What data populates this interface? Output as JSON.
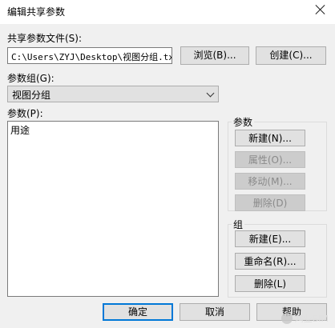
{
  "window": {
    "title": "编辑共享参数"
  },
  "file": {
    "label": "共享参数文件(S):",
    "path": "C:\\Users\\ZYJ\\Desktop\\视图分组.txt",
    "browse_label": "浏览(B)...",
    "create_label": "创建(C)..."
  },
  "param_group": {
    "label": "参数组(G):",
    "selected": "视图分组"
  },
  "params": {
    "label": "参数(P):",
    "items": [
      "用途"
    ]
  },
  "params_box": {
    "title": "参数",
    "new_label": "新建(N)...",
    "properties_label": "属性(O)...",
    "move_label": "移动(M)...",
    "delete_label": "删除(D)"
  },
  "group_box": {
    "title": "组",
    "new_label": "新建(E)...",
    "rename_label": "重命名(R)...",
    "delete_label": "删除(L)"
  },
  "footer": {
    "ok_label": "确定",
    "cancel_label": "取消",
    "help_label": "帮助"
  },
  "watermark": {
    "text": "鸿业BIM"
  }
}
